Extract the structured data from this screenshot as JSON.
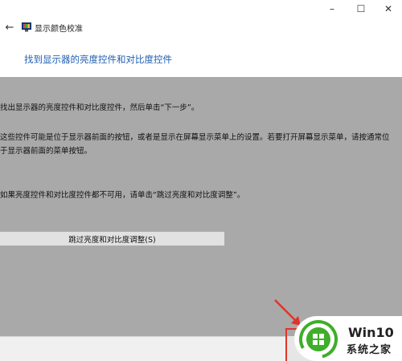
{
  "window": {
    "minimize_glyph": "–",
    "maximize_glyph": "☐",
    "close_glyph": "✕"
  },
  "header": {
    "back_glyph": "←",
    "app_title": "显示颜色校准",
    "heading": "找到显示器的亮度控件和对比度控件"
  },
  "content": {
    "paragraph1": "找出显示器的亮度控件和对比度控件，然后单击“下一步”。",
    "paragraph2": "这些控件可能是位于显示器前面的按钮，或者是显示在屏幕显示菜单上的设置。若要打开屏幕显示菜单，请按通常位于显示器前面的菜单按钮。",
    "paragraph3": "如果亮度控件和对比度控件都不可用，请单击“跳过亮度和对比度调整”。",
    "skip_button": "跳过亮度和对比度调整(S)"
  },
  "watermark": {
    "name": "Win10",
    "site": "系统之家"
  },
  "colors": {
    "heading": "#1f5fb3",
    "content_bg": "#a9a9a9",
    "highlight": "#e2332a",
    "logo_green": "#3fae2a"
  }
}
